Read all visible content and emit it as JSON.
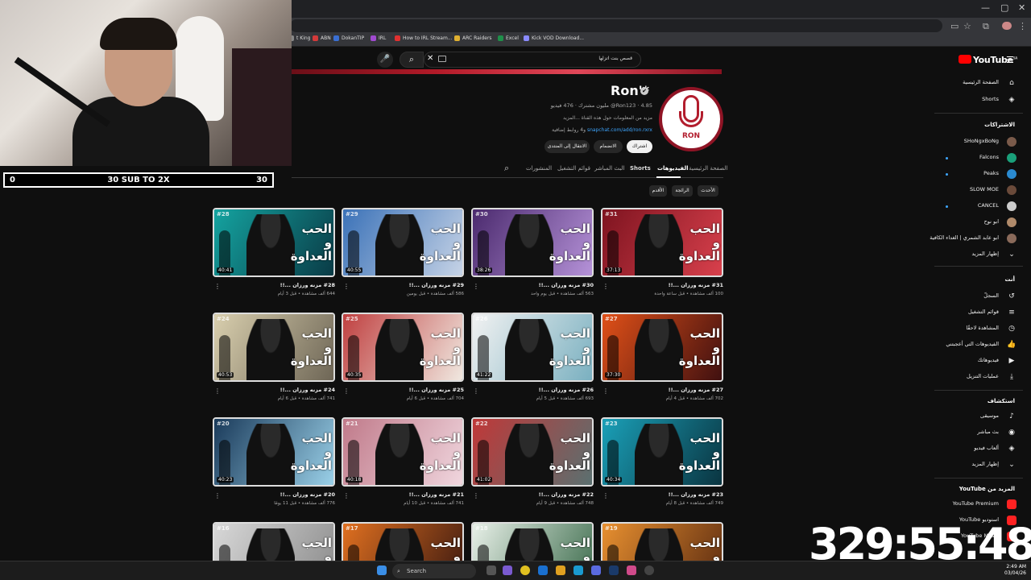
{
  "bookmarks": [
    {
      "label": "t King",
      "color": "#888888"
    },
    {
      "label": "ABN",
      "color": "#d33a3a"
    },
    {
      "label": "DokanTIP",
      "color": "#3a6fd3"
    },
    {
      "label": "IRL",
      "color": "#a04ad0"
    },
    {
      "label": "How to IRL Stream...",
      "color": "#e03030"
    },
    {
      "label": "ARC Raiders",
      "color": "#e0b030"
    },
    {
      "label": "Excel",
      "color": "#1f8f4a"
    },
    {
      "label": "Kick VOD Download...",
      "color": "#8a8aff"
    }
  ],
  "search": {
    "query": "قصص بنت اتزلها"
  },
  "channel": {
    "name": "Ron'*",
    "verified_mark": "✔",
    "avatar_text": "RON",
    "meta": "‎@Ron123 · 4.85 مليون مشترك · 476 فيديو",
    "description": "مزيد من المعلومات حول هذه القناة ...المزيد",
    "link": "snapchat.com/add/ron.rxrx",
    "links_more": "و4 روابط إضافية",
    "subscribe": "اشتراك",
    "join": "الانضمام",
    "join_community": "الانتقال إلى المنتدى"
  },
  "tabs": [
    "الصفحة الرئيسية",
    "الفيديوهات",
    "Shorts",
    "البث المباشر",
    "قوائم التشغيل",
    "المنشورات"
  ],
  "chips": [
    "الأحدث",
    "الرائجة",
    "الأقدم"
  ],
  "video_title_suffix": "مزنه ورزان ...!!",
  "thumb_text": "الحب و العداوة",
  "videos": [
    {
      "num": "#28",
      "duration": "40:41",
      "title": "#28 مزنه ورزان ...!!",
      "meta": "644 ألف مشاهدة • قبل 3 أيام",
      "c1": "#14a3a0",
      "c2": "#0a3b46"
    },
    {
      "num": "#29",
      "duration": "40:55",
      "title": "#29 مزنه ورزان ...!!",
      "meta": "586 ألف مشاهدة • قبل يومين",
      "c1": "#3b72b8",
      "c2": "#c6d3e6"
    },
    {
      "num": "#30",
      "duration": "38:26",
      "title": "#30 مزنه ورزان ...!!",
      "meta": "563 ألف مشاهدة • قبل يوم واحد",
      "c1": "#4b2a6e",
      "c2": "#b592d8"
    },
    {
      "num": "#31",
      "duration": "37:13",
      "title": "#31 مزنه ورزان ...!!",
      "meta": "100 ألف مشاهدة • قبل ساعة واحدة",
      "c1": "#7e1420",
      "c2": "#d8404c"
    },
    {
      "num": "#24",
      "duration": "40:53",
      "title": "#24 مزنه ورزان ...!!",
      "meta": "741 ألف مشاهدة • قبل 6 أيام",
      "c1": "#d9cfae",
      "c2": "#6e6656"
    },
    {
      "num": "#25",
      "duration": "40:35",
      "title": "#25 مزنه ورزان ...!!",
      "meta": "704 ألف مشاهدة • قبل 6 أيام",
      "c1": "#c04040",
      "c2": "#f0e8e0"
    },
    {
      "num": "#26",
      "duration": "41:22",
      "title": "#26 مزنه ورزان ...!!",
      "meta": "693 ألف مشاهدة • قبل 5 أيام",
      "c1": "#f2f2f2",
      "c2": "#7ab0c0"
    },
    {
      "num": "#27",
      "duration": "37:30",
      "title": "#27 مزنه ورزان ...!!",
      "meta": "702 ألف مشاهدة • قبل 4 أيام",
      "c1": "#e05018",
      "c2": "#401010"
    },
    {
      "num": "#20",
      "duration": "40:23",
      "title": "#20 مزنه ورزان ...!!",
      "meta": "776 ألف مشاهدة • قبل 11 يومًا",
      "c1": "#1a3a5a",
      "c2": "#9ad0e8"
    },
    {
      "num": "#21",
      "duration": "40:18",
      "title": "#21 مزنه ورزان ...!!",
      "meta": "741 ألف مشاهدة • قبل 10 أيام",
      "c1": "#c07a8a",
      "c2": "#f0d6de"
    },
    {
      "num": "#22",
      "duration": "41:02",
      "title": "#22 مزنه ورزان ...!!",
      "meta": "748 ألف مشاهدة • قبل 9 أيام",
      "c1": "#c03838",
      "c2": "#5a7070"
    },
    {
      "num": "#23",
      "duration": "40:34",
      "title": "#23 مزنه ورزان ...!!",
      "meta": "749 ألف مشاهدة • قبل 8 أيام",
      "c1": "#1aa0b8",
      "c2": "#0a3440"
    },
    {
      "num": "#16",
      "duration": "",
      "title": "",
      "meta": "",
      "c1": "#d8d8d8",
      "c2": "#8a8a8a"
    },
    {
      "num": "#17",
      "duration": "",
      "title": "",
      "meta": "",
      "c1": "#e07020",
      "c2": "#3a1810"
    },
    {
      "num": "#18",
      "duration": "",
      "title": "",
      "meta": "",
      "c1": "#e8f0e8",
      "c2": "#3a6a4a"
    },
    {
      "num": "#19",
      "duration": "",
      "title": "",
      "meta": "",
      "c1": "#e89030",
      "c2": "#5a2a10"
    }
  ],
  "sidebar": {
    "logo": "YouTube",
    "logo_region": "SA",
    "home": "الصفحة الرئيسية",
    "shorts": "Shorts",
    "subs_header": "الاشتراكات",
    "subs": [
      {
        "name": "SHoNgxBoNg",
        "color": "#7a5a4a",
        "live": false
      },
      {
        "name": "Falcons",
        "color": "#1aa07a",
        "live": true
      },
      {
        "name": "Peaks",
        "color": "#2a8ad0",
        "live": true
      },
      {
        "name": "SLOW MOE",
        "color": "#6a4a3a",
        "live": false
      },
      {
        "name": "CANCEL",
        "color": "#cccccc",
        "live": true
      },
      {
        "name": "ابو نوح",
        "color": "#b08a6a",
        "live": false
      },
      {
        "name": "ابو عابد الشمري | الغداء الكافية",
        "color": "#8a6a5a",
        "live": false
      }
    ],
    "show_more": "إظهار المزيد",
    "you_header": "أنت",
    "you_items": [
      {
        "label": "السجلّ",
        "icon": "history-icon",
        "glyph": "↺"
      },
      {
        "label": "قوائم التشغيل",
        "icon": "playlist-icon",
        "glyph": "≡"
      },
      {
        "label": "المشاهدة لاحقًا",
        "icon": "clock-icon",
        "glyph": "◷"
      },
      {
        "label": "الفيديوهات التي أعجبتني",
        "icon": "like-icon",
        "glyph": "👍"
      },
      {
        "label": "فيديوهاتك",
        "icon": "video-icon",
        "glyph": "▶"
      },
      {
        "label": "عمليات التنزيل",
        "icon": "download-icon",
        "glyph": "⤓"
      }
    ],
    "explore_header": "استكشاف",
    "explore_items": [
      {
        "label": "موسيقى",
        "icon": "music-icon",
        "glyph": "♪"
      },
      {
        "label": "بث مباشر",
        "icon": "live-icon",
        "glyph": "◉"
      },
      {
        "label": "ألعاب فيديو",
        "icon": "gaming-icon",
        "glyph": "◈"
      },
      {
        "label": "إظهار المزيد",
        "icon": "chevron-down-icon",
        "glyph": "⌄"
      }
    ],
    "more_header": "المزيد من YouTube",
    "more_items": [
      {
        "label": "YouTube Premium",
        "color": "#ff2222"
      },
      {
        "label": "استوديو YouTube",
        "color": "#ff2222"
      },
      {
        "label": "YouTube Music",
        "color": "#ff2222"
      }
    ]
  },
  "overlay": {
    "sub_left": "0",
    "sub_center": "30 SUB TO 2X",
    "sub_right": "30",
    "timer": "329:55:48"
  },
  "taskbar": {
    "search": "Search",
    "time": "2:49 AM",
    "date": "03/04/26"
  }
}
